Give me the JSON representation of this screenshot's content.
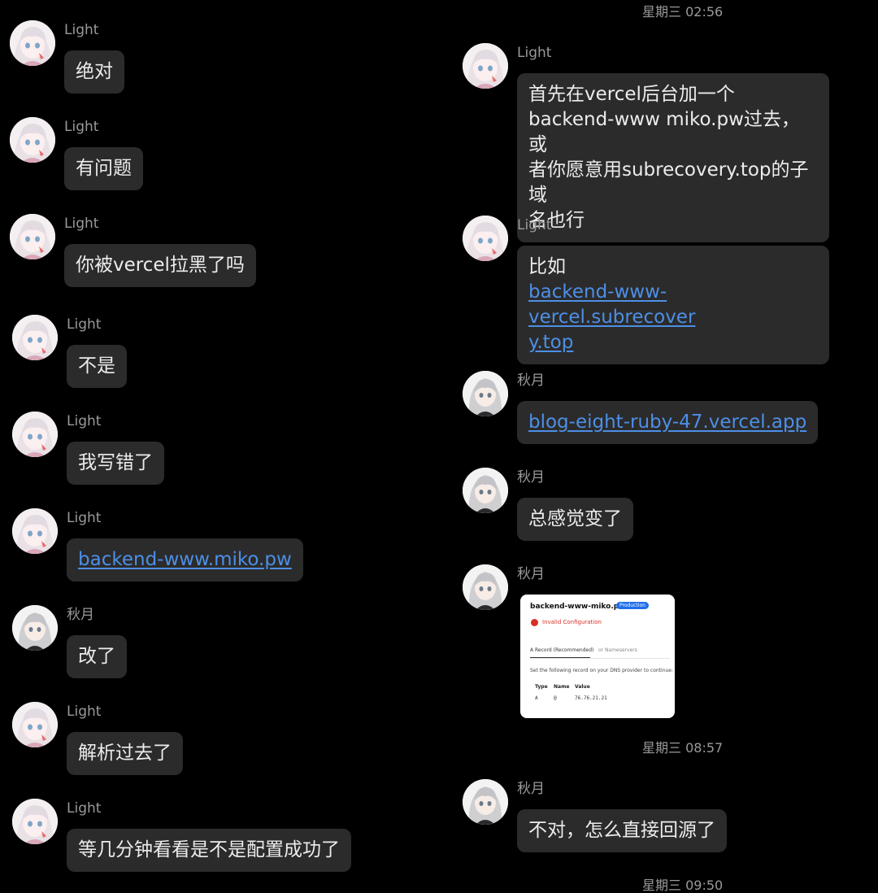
{
  "colors": {
    "background": "#000000",
    "bubble": "#2b2b2b",
    "text": "#ececec",
    "meta_text": "#9a9a9a",
    "link": "#4d8fe6"
  },
  "left_column": [
    {
      "sender": "Light",
      "avatar": "light-avatar-icon",
      "text": "绝对"
    },
    {
      "sender": "Light",
      "avatar": "light-avatar-icon",
      "text": "有问题"
    },
    {
      "sender": "Light",
      "avatar": "light-avatar-icon",
      "text": "你被vercel拉黑了吗"
    },
    {
      "sender": "Light",
      "avatar": "light-avatar-icon",
      "text": "不是"
    },
    {
      "sender": "Light",
      "avatar": "light-avatar-icon",
      "text": "我写错了"
    },
    {
      "sender": "Light",
      "avatar": "light-avatar-icon",
      "link": "backend-www.miko.pw"
    },
    {
      "sender": "秋月",
      "avatar": "qiuyue-avatar-icon",
      "text": "改了"
    },
    {
      "sender": "Light",
      "avatar": "light-avatar-icon",
      "text": "解析过去了"
    },
    {
      "sender": "Light",
      "avatar": "light-avatar-icon",
      "text": "等几分钟看看是不是配置成功了"
    }
  ],
  "right_column": {
    "timestamp_1": "星期三 02:56",
    "messages": [
      {
        "sender": "Light",
        "avatar": "light-avatar-icon",
        "lines": [
          "首先在vercel后台加一个",
          "backend-www miko.pw过去，或",
          "者你愿意用subrecovery.top的子域",
          "名也行"
        ]
      },
      {
        "sender": "Light",
        "avatar": "light-avatar-icon",
        "text": "比如",
        "link_lines": [
          "backend-www-vercel.subrecover",
          "y.top"
        ]
      },
      {
        "sender": "秋月",
        "avatar": "qiuyue-avatar-icon",
        "link": "blog-eight-ruby-47.vercel.app"
      },
      {
        "sender": "秋月",
        "avatar": "qiuyue-avatar-icon",
        "text": "总感觉变了"
      },
      {
        "sender": "秋月",
        "avatar": "qiuyue-avatar-icon",
        "image": {
          "domain": "backend-www-miko.pw",
          "badge": "Production",
          "error": "Invalid Configuration",
          "tab_active": "A Record (Recommended)",
          "tab_other": "or Nameservers",
          "instruction": "Set the following record on your DNS provider to continue:",
          "headers": [
            "Type",
            "Name",
            "Value"
          ],
          "row": [
            "A",
            "@",
            "76.76.21.21"
          ]
        }
      }
    ],
    "timestamp_2": "星期三 08:57",
    "message_after": {
      "sender": "秋月",
      "avatar": "qiuyue-avatar-icon",
      "text": "不对，怎么直接回源了"
    },
    "timestamp_3": "星期三 09:50"
  }
}
